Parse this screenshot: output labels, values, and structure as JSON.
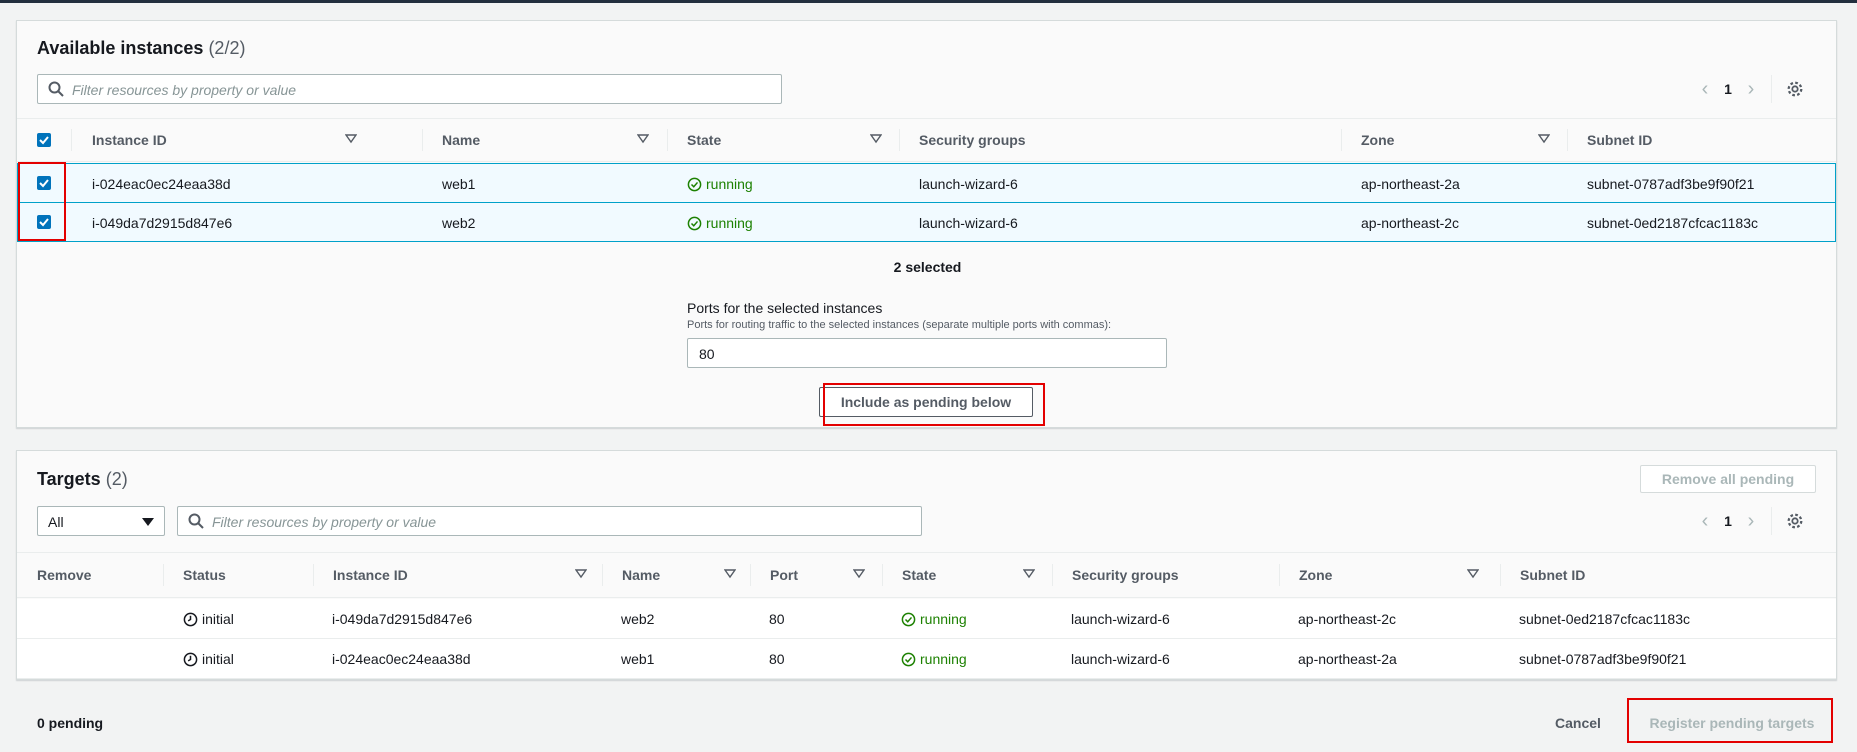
{
  "available": {
    "title": "Available instances",
    "count": "(2/2)",
    "filter_placeholder": "Filter resources by property or value",
    "page": "1",
    "columns": [
      "Instance ID",
      "Name",
      "State",
      "Security groups",
      "Zone",
      "Subnet ID"
    ],
    "rows": [
      {
        "instance_id": "i-024eac0ec24eaa38d",
        "name": "web1",
        "state": "running",
        "security_group": "launch-wizard-6",
        "zone": "ap-northeast-2a",
        "subnet": "subnet-0787adf3be9f90f21"
      },
      {
        "instance_id": "i-049da7d2915d847e6",
        "name": "web2",
        "state": "running",
        "security_group": "launch-wizard-6",
        "zone": "ap-northeast-2c",
        "subnet": "subnet-0ed2187cfcac1183c"
      }
    ],
    "selected_text": "2 selected",
    "ports_label": "Ports for the selected instances",
    "ports_desc": "Ports for routing traffic to the selected instances (separate multiple ports with commas):",
    "ports_value": "80",
    "include_button": "Include as pending below"
  },
  "targets": {
    "title": "Targets",
    "count": "(2)",
    "remove_all_button": "Remove all pending",
    "filter_select": "All",
    "filter_placeholder": "Filter resources by property or value",
    "page": "1",
    "columns": [
      "Remove",
      "Status",
      "Instance ID",
      "Name",
      "Port",
      "State",
      "Security groups",
      "Zone",
      "Subnet ID"
    ],
    "rows": [
      {
        "status": "initial",
        "instance_id": "i-049da7d2915d847e6",
        "name": "web2",
        "port": "80",
        "state": "running",
        "security_group": "launch-wizard-6",
        "zone": "ap-northeast-2c",
        "subnet": "subnet-0ed2187cfcac1183c"
      },
      {
        "status": "initial",
        "instance_id": "i-024eac0ec24eaa38d",
        "name": "web1",
        "port": "80",
        "state": "running",
        "security_group": "launch-wizard-6",
        "zone": "ap-northeast-2a",
        "subnet": "subnet-0787adf3be9f90f21"
      }
    ]
  },
  "footer": {
    "pending": "0 pending",
    "cancel_button": "Cancel",
    "register_button": "Register pending targets"
  },
  "colors": {
    "checkbox": "#0073bb",
    "running": "#1d8102",
    "highlight": "#e30000",
    "selected_row": "#f1faff"
  }
}
